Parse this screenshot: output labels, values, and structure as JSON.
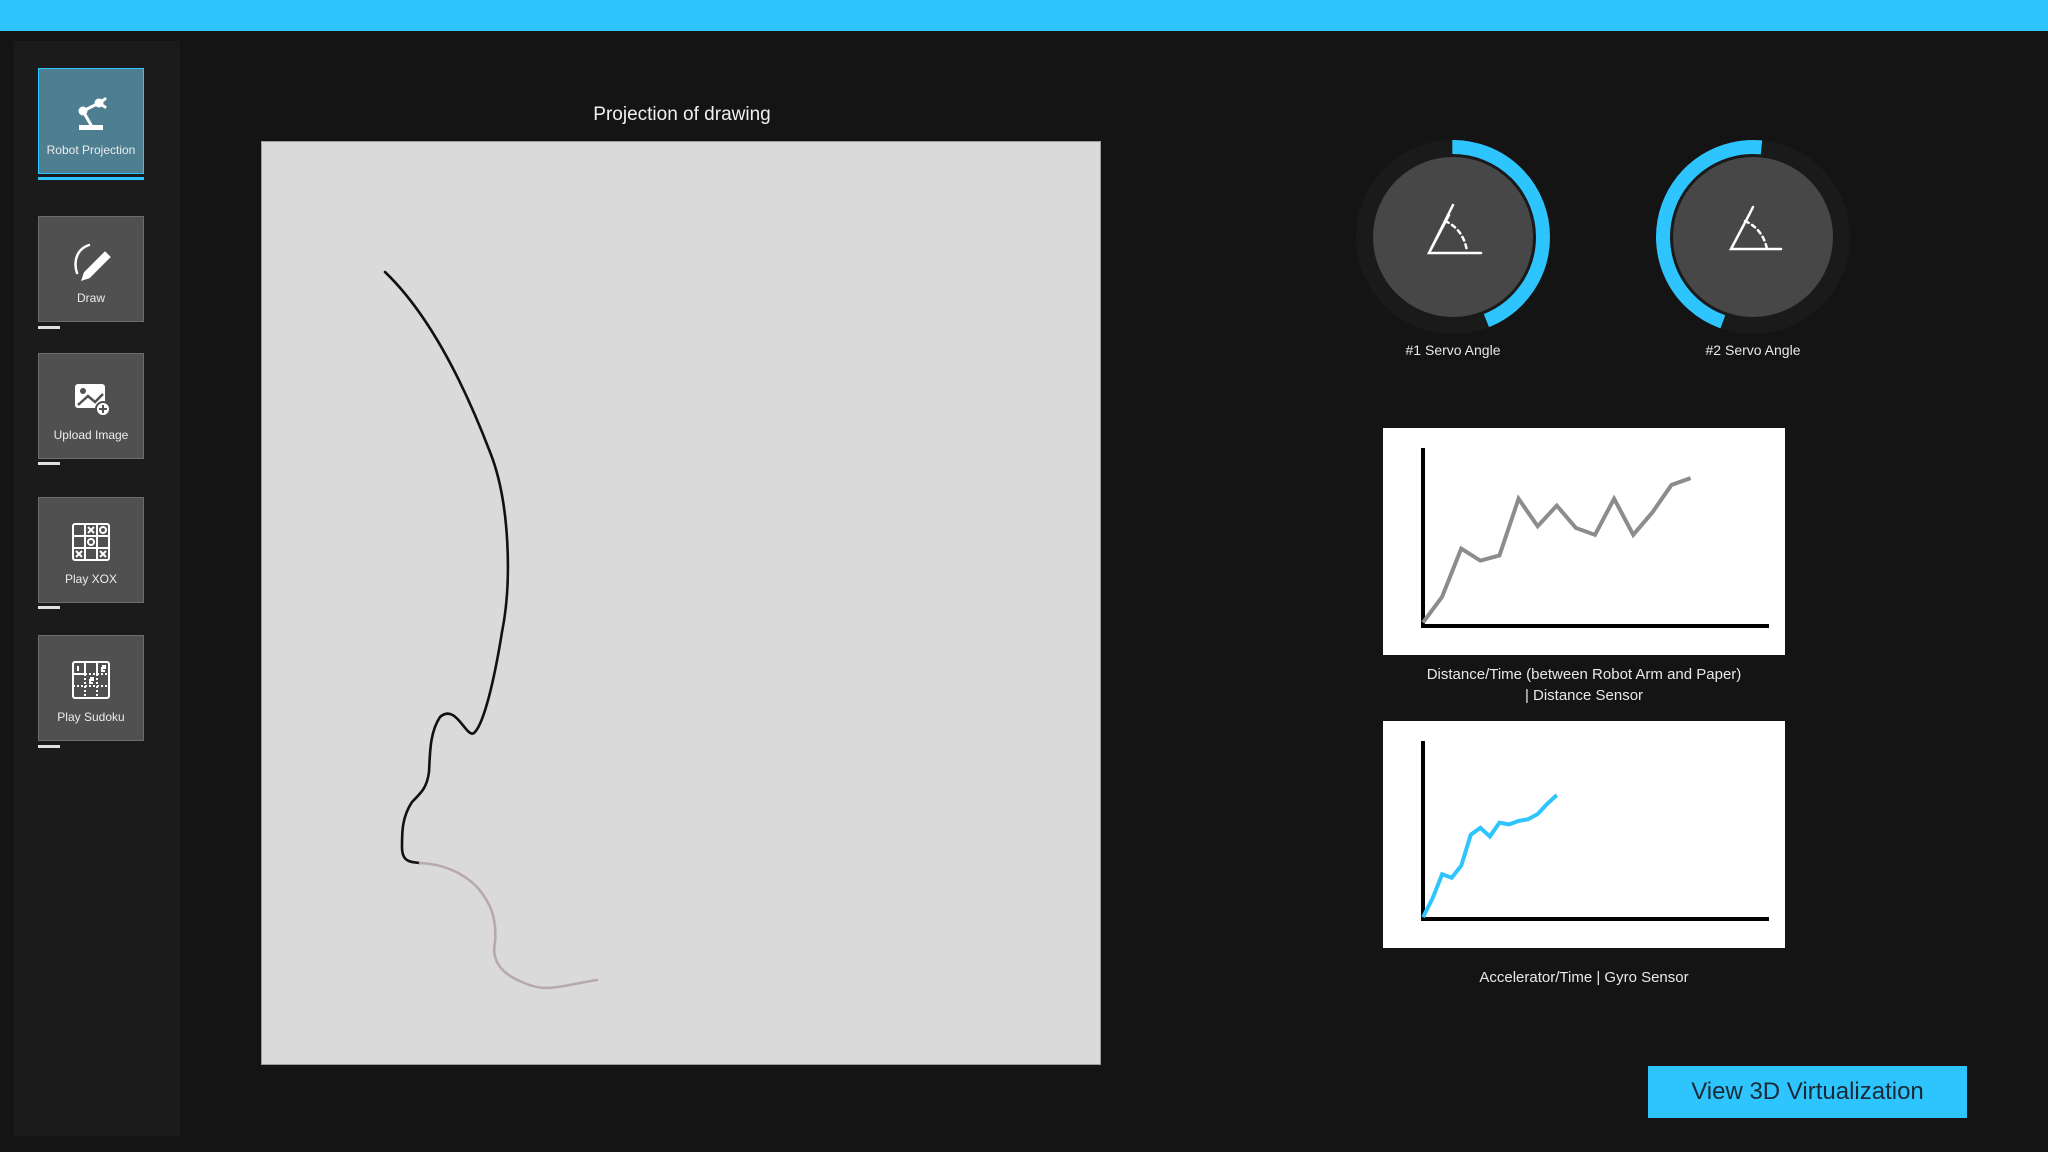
{
  "colors": {
    "accent": "#2ec4fd",
    "background": "#141414",
    "canvas": "#dadada"
  },
  "sidebar": {
    "items": [
      {
        "label": "Robot Projection",
        "icon": "robot-arm-icon",
        "active": true
      },
      {
        "label": "Draw",
        "icon": "pen-drawing-icon",
        "active": false
      },
      {
        "label": "Upload Image",
        "icon": "image-add-icon",
        "active": false
      },
      {
        "label": "Play XOX",
        "icon": "tic-tac-toe-icon",
        "active": false
      },
      {
        "label": "Play Sudoku",
        "icon": "sudoku-grid-icon",
        "active": false
      }
    ]
  },
  "canvas": {
    "title": "Projection of drawing"
  },
  "gauges": [
    {
      "label": "#1 Servo Angle",
      "icon": "angle-icon",
      "value_fraction": 0.44
    },
    {
      "label": "#2 Servo Angle",
      "icon": "angle-icon",
      "value_fraction": 0.46
    }
  ],
  "charts": {
    "distance": {
      "caption_line1": "Distance/Time (between Robot Arm and Paper)",
      "caption_line2": "| Distance Sensor"
    },
    "gyro": {
      "caption": "Accelerator/Time | Gyro Sensor"
    }
  },
  "chart_data": [
    {
      "type": "line",
      "title": "Distance/Time (between Robot Arm and Paper) | Distance Sensor",
      "xlabel": "",
      "ylabel": "",
      "xlim": [
        0,
        18
      ],
      "ylim": [
        0,
        100
      ],
      "series": [
        {
          "color": "#8c8c8c",
          "x": [
            0,
            1,
            2,
            3,
            4,
            5,
            6,
            7,
            8,
            9,
            10,
            11,
            12,
            13,
            14
          ],
          "y": [
            2,
            17,
            45,
            38,
            41,
            74,
            58,
            70,
            57,
            53,
            74,
            53,
            66,
            82,
            86
          ]
        }
      ]
    },
    {
      "type": "line",
      "title": "Accelerator/Time | Gyro Sensor",
      "xlabel": "",
      "ylabel": "",
      "xlim": [
        0,
        18
      ],
      "ylim": [
        0,
        100
      ],
      "series": [
        {
          "color": "#2ec4fd",
          "x": [
            0,
            0.5,
            1,
            1.5,
            2,
            2.5,
            3,
            3.5,
            4,
            4.5,
            5,
            5.5,
            6,
            6.5,
            7
          ],
          "y": [
            1,
            12,
            26,
            24,
            31,
            49,
            53,
            48,
            56,
            55,
            57,
            58,
            61,
            67,
            72
          ]
        }
      ]
    }
  ],
  "cta": {
    "label": "View 3D Virtualization"
  }
}
